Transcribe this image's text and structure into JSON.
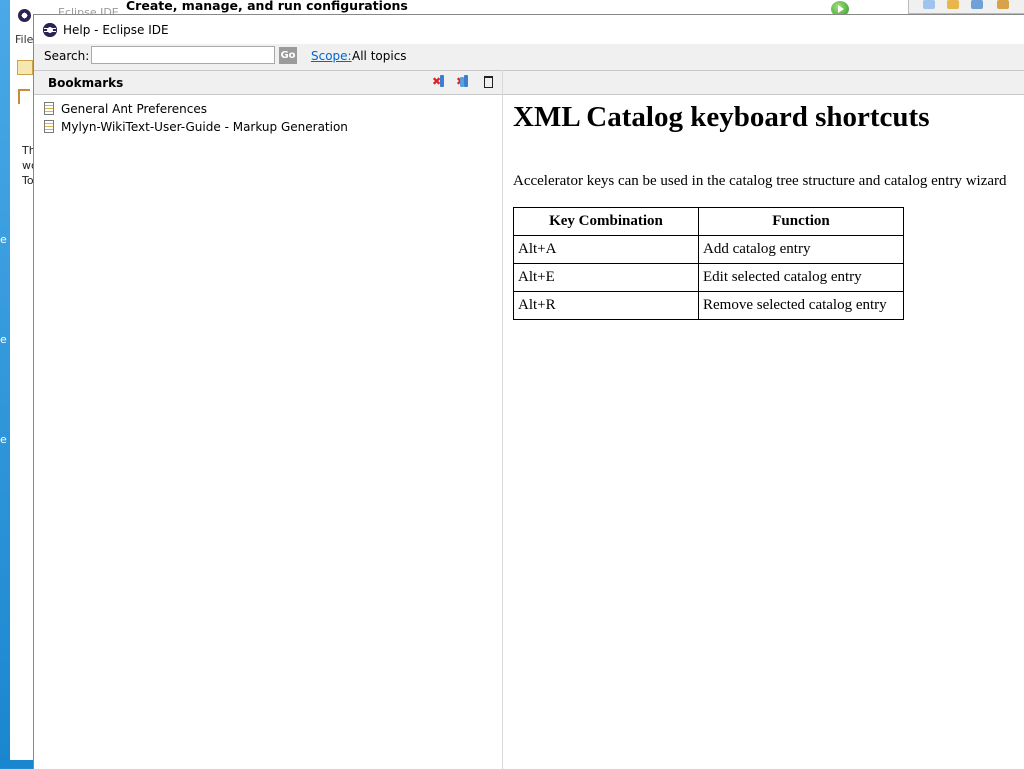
{
  "background": {
    "eclipse_title": "Eclipse IDE",
    "menu_file": "File",
    "side_text_1": "Th",
    "side_text_2": "wo",
    "side_text_3": "To",
    "edge_letter": "e",
    "launch_dialog_title": "Create, manage, and run configurations"
  },
  "window": {
    "title": "Help - Eclipse IDE"
  },
  "search": {
    "label": "Search:",
    "value": "",
    "go_label": "Go",
    "scope_link": "Scope:",
    "scope_value": "All topics"
  },
  "bookmarks": {
    "title": "Bookmarks",
    "items": [
      {
        "label": "General Ant Preferences"
      },
      {
        "label": "Mylyn-WikiText-User-Guide - Markup Generation"
      }
    ]
  },
  "page": {
    "heading": "XML Catalog keyboard shortcuts",
    "intro": "Accelerator keys can be used in the catalog tree structure and catalog entry wizard",
    "table": {
      "headers": [
        "Key Combination",
        "Function"
      ],
      "rows": [
        [
          "Alt+A",
          "Add catalog entry"
        ],
        [
          "Alt+E",
          "Edit selected catalog entry"
        ],
        [
          "Alt+R",
          "Remove selected catalog entry"
        ]
      ]
    }
  },
  "colors": {
    "desktop": "#1e8fd6",
    "link": "#0066cc",
    "go_button": "#9b9b9b",
    "header_bg": "#f0f0f0"
  }
}
